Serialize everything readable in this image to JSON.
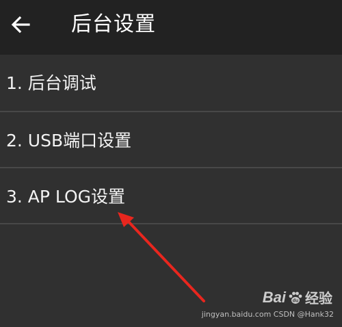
{
  "header": {
    "back_icon": "arrow-left-icon",
    "title": "后台设置"
  },
  "menu": {
    "items": [
      {
        "label": "1. 后台调试"
      },
      {
        "label": "2. USB端口设置"
      },
      {
        "label": "3. AP LOG设置"
      }
    ]
  },
  "annotation": {
    "arrow_icon": "red-arrow-icon",
    "arrow_color": "#e8261e"
  },
  "watermark": {
    "brand": "Bai",
    "paw_icon": "paw-icon",
    "brand_suffix": "经验",
    "subtext": "jingyan.baidu.com  CSDN @Hank32"
  },
  "colors": {
    "background": "#303030",
    "app_bar": "#222222",
    "divider": "#484848",
    "text": "#f2f2f2"
  }
}
